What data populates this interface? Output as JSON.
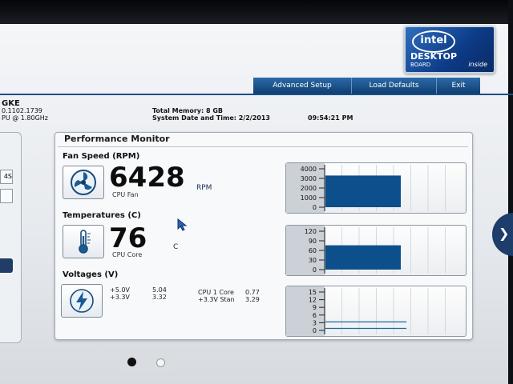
{
  "brand": {
    "logo": "intel",
    "product": "DESKTOP",
    "sub": "BOARD",
    "inside": "inside"
  },
  "menu": {
    "advanced_setup": "Advanced Setup",
    "load_defaults": "Load Defaults",
    "exit": "Exit"
  },
  "system": {
    "board_name": "GKE",
    "bios_version": "0.1102.1739",
    "cpu_speed": "PU @ 1.80GHz",
    "total_memory": "Total Memory: 8 GB",
    "date_time_label": "System Date and Time: 2/2/2013",
    "time": "09:54:21 PM"
  },
  "left_panel": {
    "btn1": "4S"
  },
  "perf": {
    "title": "Performance Monitor",
    "fan": {
      "label": "Fan Speed (RPM)",
      "value": "6428",
      "unit": "RPM",
      "sublabel": "CPU Fan",
      "graph": {
        "ticks": [
          "4000",
          "3000",
          "2000",
          "1000",
          "0"
        ],
        "max": 4000,
        "level": 3300
      }
    },
    "temp": {
      "label": "Temperatures (C)",
      "value": "76",
      "unit": "C",
      "sublabel": "CPU Core",
      "graph": {
        "ticks": [
          "120",
          "90",
          "60",
          "30",
          "0"
        ],
        "max": 120,
        "level": 76
      }
    },
    "volt": {
      "label": "Voltages (V)",
      "rows": [
        {
          "name": "+5.0V",
          "value": "5.04",
          "name2": "CPU 1 Core",
          "value2": "0.77"
        },
        {
          "name": "+3.3V",
          "value": "3.32",
          "name2": "+3.3V Stan",
          "value2": "3.29"
        }
      ],
      "graph": {
        "ticks": [
          "15",
          "12",
          "9",
          "6",
          "3",
          "0"
        ],
        "max": 15,
        "levels": [
          3.32,
          0.77
        ]
      }
    }
  },
  "colors": {
    "bar": "#0d4f8b",
    "menu": "#1c4f86"
  },
  "icons": {
    "fan": "fan-icon",
    "temp": "thermometer-icon",
    "volt": "lightning-icon",
    "cursor": "mouse-cursor-icon",
    "next": "chevron-right-icon"
  }
}
